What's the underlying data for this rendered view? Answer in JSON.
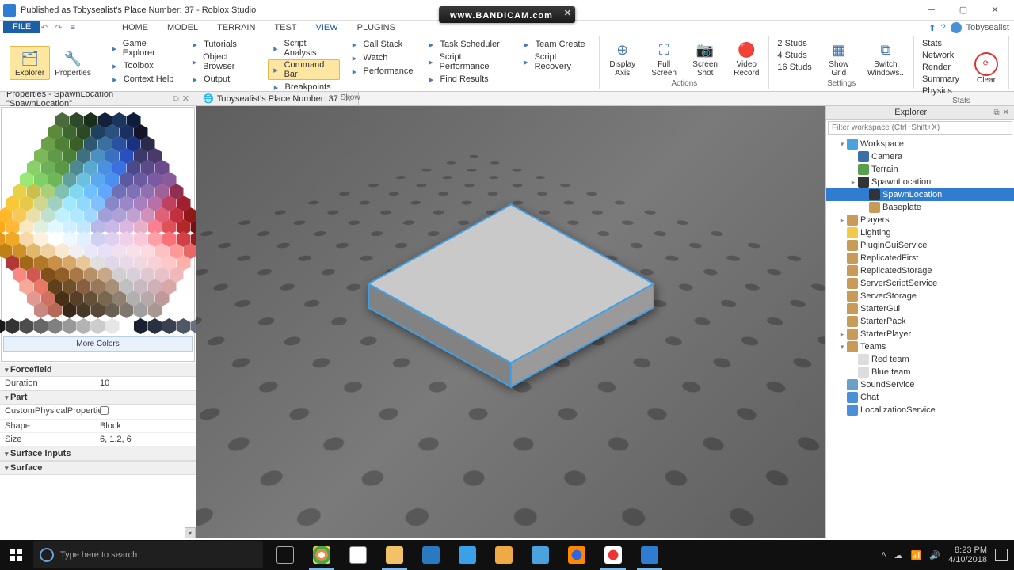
{
  "window": {
    "title": "Published as Tobysealist's Place Number: 37 - Roblox Studio"
  },
  "bandicam": {
    "text": "www.BANDICAM.com"
  },
  "file_tab": "FILE",
  "menu_tabs": [
    "HOME",
    "MODEL",
    "TERRAIN",
    "TEST",
    "VIEW",
    "PLUGINS"
  ],
  "active_menu": "VIEW",
  "username": "Tobysealist",
  "ribbon": {
    "explorer": "Explorer",
    "properties": "Properties",
    "show": {
      "title": "Show",
      "col1": [
        "Game Explorer",
        "Toolbox",
        "Context Help"
      ],
      "col2": [
        "Tutorials",
        "Object Browser",
        "Output"
      ],
      "col3": [
        "Script Analysis",
        "Command Bar",
        "Breakpoints"
      ],
      "col3_active": "Command Bar",
      "col4": [
        "Call Stack",
        "Watch",
        "Performance"
      ],
      "col5": [
        "Task Scheduler",
        "Script Performance",
        "Find Results"
      ],
      "col6": [
        "Team Create",
        "Script Recovery"
      ]
    },
    "actions": {
      "title": "Actions",
      "items": [
        "Display\nAxis",
        "Full\nScreen",
        "Screen\nShot",
        "Video\nRecord"
      ]
    },
    "grid": {
      "studs": [
        "2 Studs",
        "4 Studs",
        "16 Studs"
      ],
      "show_grid": "Show\nGrid",
      "switch": "Switch\nWindows..",
      "clear": "Clear"
    },
    "settings": {
      "title": "Settings",
      "items": [
        "Stats",
        "Render",
        "Physics",
        "Network",
        "Summary"
      ]
    },
    "stats_title": "Stats"
  },
  "doc_tabs": {
    "props": "Properties - SpawnLocation \"SpawnLocation\"",
    "place": "Tobysealist's Place Number: 37"
  },
  "colorpicker": {
    "more": "More Colors"
  },
  "properties": {
    "forcefield": {
      "name": "Forcefield",
      "duration_label": "Duration",
      "duration_value": "10"
    },
    "part": {
      "name": "Part",
      "custom_label": "CustomPhysicalProperties",
      "shape_label": "Shape",
      "shape_value": "Block",
      "size_label": "Size",
      "size_value": "6, 1.2, 6"
    },
    "surface_inputs": "Surface Inputs",
    "surface": "Surface"
  },
  "explorer": {
    "title": "Explorer",
    "filter_placeholder": "Filter workspace (Ctrl+Shift+X)",
    "tree": [
      {
        "l": 0,
        "arrow": "▾",
        "icon": "#4aa3df",
        "name": "Workspace"
      },
      {
        "l": 1,
        "arrow": "",
        "icon": "#3b6fa8",
        "name": "Camera"
      },
      {
        "l": 1,
        "arrow": "",
        "icon": "#5aa04a",
        "name": "Terrain"
      },
      {
        "l": 1,
        "arrow": "▸",
        "icon": "#333",
        "name": "SpawnLocation"
      },
      {
        "l": 2,
        "arrow": "",
        "icon": "#333",
        "name": "SpawnLocation",
        "sel": true
      },
      {
        "l": 2,
        "arrow": "",
        "icon": "#c89b58",
        "name": "Baseplate"
      },
      {
        "l": 0,
        "arrow": "▸",
        "icon": "#c89b58",
        "name": "Players"
      },
      {
        "l": 0,
        "arrow": "",
        "icon": "#f3c94a",
        "name": "Lighting"
      },
      {
        "l": 0,
        "arrow": "",
        "icon": "#c89b58",
        "name": "PluginGuiService"
      },
      {
        "l": 0,
        "arrow": "",
        "icon": "#c89b58",
        "name": "ReplicatedFirst"
      },
      {
        "l": 0,
        "arrow": "",
        "icon": "#c89b58",
        "name": "ReplicatedStorage"
      },
      {
        "l": 0,
        "arrow": "",
        "icon": "#c89b58",
        "name": "ServerScriptService"
      },
      {
        "l": 0,
        "arrow": "",
        "icon": "#c89b58",
        "name": "ServerStorage"
      },
      {
        "l": 0,
        "arrow": "",
        "icon": "#c89b58",
        "name": "StarterGui"
      },
      {
        "l": 0,
        "arrow": "",
        "icon": "#c89b58",
        "name": "StarterPack"
      },
      {
        "l": 0,
        "arrow": "▸",
        "icon": "#c89b58",
        "name": "StarterPlayer"
      },
      {
        "l": 0,
        "arrow": "▾",
        "icon": "#c89b58",
        "name": "Teams"
      },
      {
        "l": 1,
        "arrow": "",
        "icon": "#ddd",
        "name": "Red team"
      },
      {
        "l": 1,
        "arrow": "",
        "icon": "#ddd",
        "name": "Blue team"
      },
      {
        "l": 0,
        "arrow": "",
        "icon": "#6aa0c8",
        "name": "SoundService"
      },
      {
        "l": 0,
        "arrow": "",
        "icon": "#4a90d9",
        "name": "Chat"
      },
      {
        "l": 0,
        "arrow": "",
        "icon": "#4a90d9",
        "name": "LocalizationService"
      }
    ]
  },
  "taskbar": {
    "search_placeholder": "Type here to search",
    "time": "8:23 PM",
    "date": "4/10/2018"
  }
}
